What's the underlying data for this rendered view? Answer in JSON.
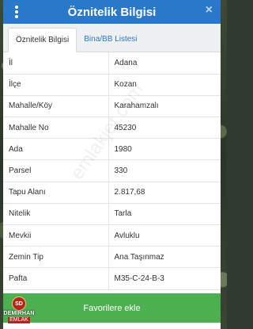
{
  "header": {
    "title": "Öznitelik Bilgisi",
    "close_label": "×"
  },
  "tabs": [
    {
      "label": "Öznitelik Bilgisi",
      "active": true
    },
    {
      "label": "Bina/BB Listesi",
      "active": false
    }
  ],
  "attributes": [
    {
      "key": "İl",
      "value": "Adana"
    },
    {
      "key": "İlçe",
      "value": "Kozan"
    },
    {
      "key": "Mahalle/Köy",
      "value": "Karahamzalı"
    },
    {
      "key": "Mahalle No",
      "value": "45230"
    },
    {
      "key": "Ada",
      "value": "1980"
    },
    {
      "key": "Parsel",
      "value": "330"
    },
    {
      "key": "Tapu Alanı",
      "value": "2.817,68"
    },
    {
      "key": "Nitelik",
      "value": "Tarla"
    },
    {
      "key": "Mevkii",
      "value": "Avluklu"
    },
    {
      "key": "Zemin Tip",
      "value": "Ana Taşınmaz"
    },
    {
      "key": "Pafta",
      "value": "M35-C-24-B-3"
    }
  ],
  "favorites_button": {
    "label": "Favorilere ekle"
  },
  "watermark": "emlakjet.com",
  "logo": {
    "initials": "SD",
    "name": "DEMİRHAN",
    "sub": "EMLAK"
  },
  "colors": {
    "header": "#2a78c9",
    "button": "#4caf50",
    "tab_link": "#2a78c9"
  }
}
